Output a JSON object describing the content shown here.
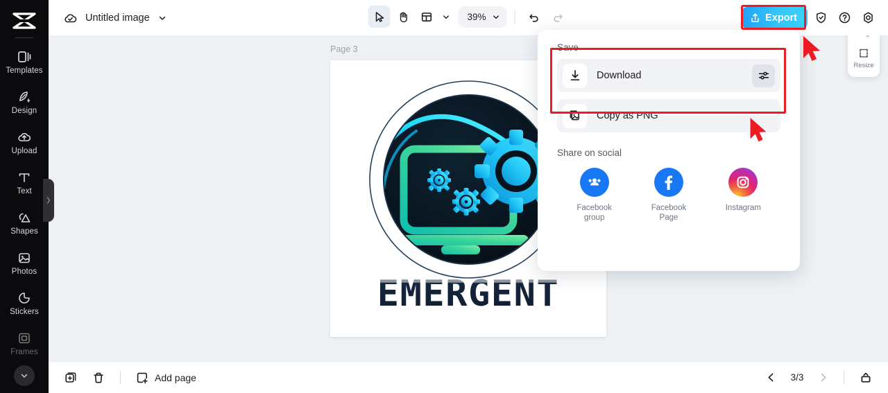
{
  "app": {
    "accent_color": "#3ad3fd",
    "highlight_color": "#ee1b24",
    "sidebar_bg": "#0b0b0d",
    "canvas_bg": "#eef1f4"
  },
  "topbar": {
    "cloud_icon": "cloud-check-icon",
    "doc_title": "Untitled image",
    "title_chevron_icon": "chevron-down-icon",
    "tools": [
      {
        "name": "select-tool",
        "icon": "cursor-arrow-icon",
        "active": true
      },
      {
        "name": "hand-tool",
        "icon": "hand-icon",
        "active": false
      },
      {
        "name": "layout-tool",
        "icon": "layout-grid-icon",
        "active": false
      }
    ],
    "layout_chevron_icon": "chevron-down-icon",
    "zoom_value": "39%",
    "zoom_chevron_icon": "chevron-down-icon",
    "undo_icon": "undo-arrow-icon",
    "redo_icon": "redo-arrow-icon",
    "export_label": "Export",
    "export_icon": "share-upload-icon",
    "header_icons": [
      {
        "name": "shield-check-icon"
      },
      {
        "name": "help-circle-icon"
      },
      {
        "name": "settings-gear-icon"
      }
    ]
  },
  "sidebar": {
    "logo_icon": "capcut-logo-icon",
    "items": [
      {
        "label": "Templates",
        "icon": "templates-icon",
        "dim": false
      },
      {
        "label": "Design",
        "icon": "design-icon",
        "dim": false
      },
      {
        "label": "Upload",
        "icon": "upload-cloud-icon",
        "dim": false
      },
      {
        "label": "Text",
        "icon": "text-t-icon",
        "dim": false
      },
      {
        "label": "Shapes",
        "icon": "shapes-icon",
        "dim": false
      },
      {
        "label": "Photos",
        "icon": "photos-image-icon",
        "dim": false
      },
      {
        "label": "Stickers",
        "icon": "stickers-icon",
        "dim": false
      },
      {
        "label": "Frames",
        "icon": "frames-icon",
        "dim": true
      }
    ],
    "collapse_icon": "chevron-down-icon",
    "handle_icon": "chevron-right-icon"
  },
  "canvas": {
    "page_label": "Page 3",
    "artwork": {
      "title_text": "EMERGENT",
      "badge_bg": "#0b1a24",
      "laptop_gradient_start": "#6ee7a0",
      "laptop_gradient_end": "#17c9b5",
      "gear_gradient_start": "#22d3ee",
      "gear_gradient_end": "#0ea5e9",
      "ring_color": "#20394d",
      "title_color": "#17253a"
    }
  },
  "right_panel": {
    "items": [
      {
        "label": "Backgr...",
        "icon": "background-pattern-icon"
      },
      {
        "label": "Resize",
        "icon": "resize-icon"
      }
    ]
  },
  "export_menu": {
    "save_heading": "Save",
    "rows": [
      {
        "label": "Download",
        "icon": "download-icon",
        "has_settings": true,
        "settings_icon": "sliders-icon"
      },
      {
        "label": "Copy as PNG",
        "icon": "copy-image-icon",
        "has_settings": false
      }
    ],
    "share_heading": "Share on social",
    "socials": [
      {
        "label": "Facebook\ngroup",
        "label_line1": "Facebook",
        "label_line2": "group",
        "icon": "facebook-group-icon",
        "color": "#1877f2"
      },
      {
        "label": "Facebook\nPage",
        "label_line1": "Facebook",
        "label_line2": "Page",
        "icon": "facebook-page-icon",
        "color": "#1877f2"
      },
      {
        "label": "Instagram",
        "label_line1": "Instagram",
        "label_line2": "",
        "icon": "instagram-icon",
        "color": "#e1306c"
      }
    ]
  },
  "bottombar": {
    "duplicate_icon": "duplicate-page-icon",
    "delete_icon": "trash-icon",
    "add_page_label": "Add page",
    "add_page_icon": "add-page-icon",
    "prev_icon": "chevron-left-icon",
    "page_counter": "3/3",
    "next_icon": "chevron-right-icon",
    "grid_view_icon": "page-grid-icon"
  }
}
